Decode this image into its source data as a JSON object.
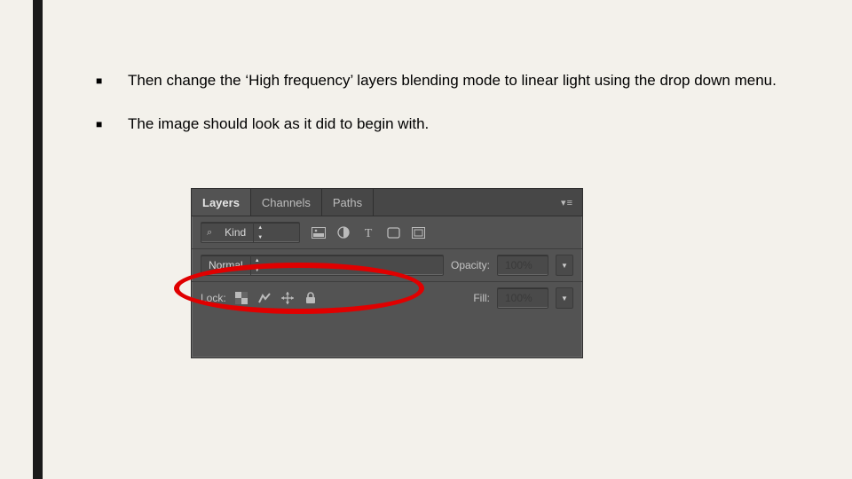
{
  "bullets": [
    "Then change the ‘High frequency’  layers blending mode to linear light using the drop down menu.",
    "The image should look as it did to begin with."
  ],
  "panel": {
    "tabs": {
      "layers": "Layers",
      "channels": "Channels",
      "paths": "Paths"
    },
    "filter_kind": "Kind",
    "blend_mode": "Normal",
    "opacity_label": "Opacity:",
    "opacity_value": "100%",
    "lock_label": "Lock:",
    "fill_label": "Fill:",
    "fill_value": "100%"
  }
}
